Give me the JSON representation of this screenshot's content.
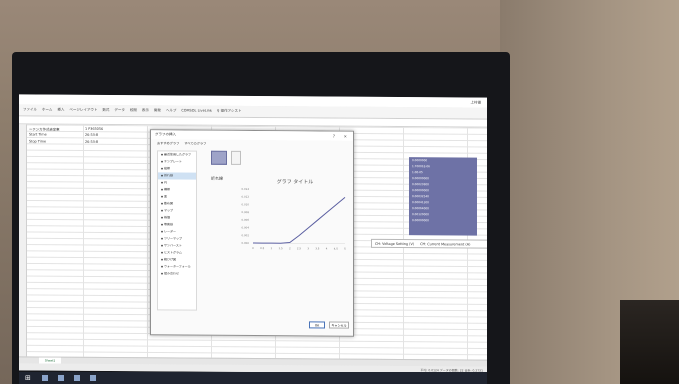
{
  "app": {
    "title": "",
    "ribbon_tabs": [
      "ファイル",
      "ホーム",
      "挿入",
      "ページレイアウト",
      "数式",
      "データ",
      "校閲",
      "表示",
      "開発",
      "ヘルプ",
      "COMSOL LiveLink",
      "♀ 操作アシスト"
    ],
    "user": "上村優"
  },
  "sheet": {
    "cells": [
      {
        "text": "ーテンカ作式表定東",
        "col": 0,
        "row": 0
      },
      {
        "text": "1  F365056",
        "col": 1,
        "row": 0
      },
      {
        "text": "Start Time",
        "col": 0,
        "row": 1
      },
      {
        "text": "26:53:8",
        "col": 1,
        "row": 1
      },
      {
        "text": "Stop Time",
        "col": 0,
        "row": 2
      },
      {
        "text": "26:53:8",
        "col": 1,
        "row": 2
      }
    ],
    "column_headers": [
      "CH: Voltage Setting (V)",
      "CH: Current Measurement (A)"
    ],
    "selected_values": [
      "0.0000000",
      "1.70001E-06",
      "1.0E-05",
      "0.00000000",
      "0.00023800",
      "0.00000000",
      "0.00032540",
      "0.00041300",
      "0.00064000",
      "0.00120000",
      "0.00000000"
    ],
    "tab_name": "Sheet1",
    "status": "平均: 0.0124   データの個数: 22   合計: 0.2731"
  },
  "dialog": {
    "title": "グラフの挿入",
    "tabs": [
      "おすすめグラフ",
      "すべてのグラフ"
    ],
    "sidebar_items": [
      "最近使用したグラフ",
      "テンプレート",
      "縦棒",
      "折れ線",
      "円",
      "横棒",
      "面",
      "散布図",
      "マップ",
      "株価",
      "等高線",
      "レーダー",
      "ツリーマップ",
      "サンバースト",
      "ヒストグラム",
      "箱ひげ図",
      "ウォーターフォール",
      "組み合わせ"
    ],
    "active_index": 3,
    "subtitle": "折れ線",
    "ok_label": "OK",
    "cancel_label": "キャンセル",
    "help": "?",
    "close": "×"
  },
  "chart_data": {
    "type": "line",
    "title": "グラフ タイトル",
    "x": [
      0,
      0.5,
      1,
      1.5,
      2,
      2.5,
      3,
      3.5,
      4,
      4.5,
      5
    ],
    "series": [
      {
        "values": [
          0,
          0,
          0,
          0,
          0.0002,
          0.002,
          0.004,
          0.006,
          0.008,
          0.01,
          0.012
        ]
      }
    ],
    "ylim": [
      0,
      0.014
    ],
    "y_ticks": [
      "0.014",
      "0.012",
      "0.010",
      "0.008",
      "0.006",
      "0.004",
      "0.002",
      "0.000"
    ],
    "x_ticks": [
      "0",
      "0.5",
      "1",
      "1.5",
      "2",
      "2.5",
      "3",
      "3.5",
      "4",
      "4.5",
      "5"
    ],
    "colors": {
      "line": "#5b5fa1"
    }
  },
  "colors": {
    "selection": "#6e72a6",
    "taskbar": "#1f2430"
  }
}
